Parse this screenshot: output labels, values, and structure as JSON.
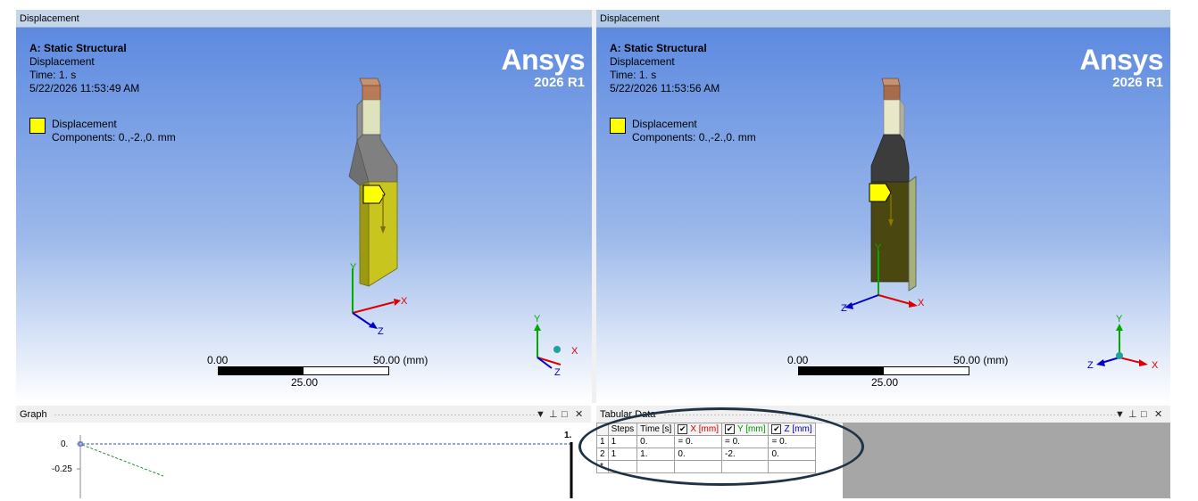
{
  "left_pane": {
    "title": "Displacement",
    "info": {
      "analysis": "A: Static Structural",
      "result": "Displacement",
      "time": "Time: 1. s",
      "date": "5/22/2026 11:53:49 AM"
    },
    "legend": {
      "label": "Displacement",
      "components": "Components: 0.,-2.,0. mm"
    },
    "brand": {
      "name": "Ansys",
      "version": "2026 R1"
    },
    "scale": {
      "min": "0.00",
      "max": "50.00 (mm)",
      "mid": "25.00"
    },
    "triad_model": {
      "x": "X",
      "y": "Y",
      "z": "Z"
    },
    "triad_corner": {
      "x": "X",
      "y": "Y",
      "z": "Z"
    }
  },
  "right_pane": {
    "title": "Displacement",
    "info": {
      "analysis": "A: Static Structural",
      "result": "Displacement",
      "time": "Time: 1. s",
      "date": "5/22/2026 11:53:56 AM"
    },
    "legend": {
      "label": "Displacement",
      "components": "Components: 0.,-2.,0. mm"
    },
    "brand": {
      "name": "Ansys",
      "version": "2026 R1"
    },
    "scale": {
      "min": "0.00",
      "max": "50.00 (mm)",
      "mid": "25.00"
    },
    "triad_model": {
      "x": "X",
      "y": "Y",
      "z": "Z"
    },
    "triad_corner": {
      "x": "X",
      "y": "Y",
      "z": "Z"
    }
  },
  "graph": {
    "title": "Graph",
    "controls": {
      "dropdown": "▼",
      "pin": "⊥",
      "maximize": "□",
      "close": "✕"
    },
    "y_ticks": [
      "0.",
      "-0.25"
    ],
    "x_marker": "1.",
    "colors": {
      "x_series": "#2d4bd6",
      "y_series": "#2a8a2a"
    }
  },
  "tabular": {
    "title": "Tabular Data",
    "controls": {
      "dropdown": "▼",
      "pin": "⊥",
      "maximize": "□",
      "close": "✕"
    },
    "headers": {
      "steps": "Steps",
      "time": "Time [s]",
      "x": "X [mm]",
      "y": "Y [mm]",
      "z": "Z [mm]"
    },
    "rows": [
      {
        "index": "1",
        "steps": "1",
        "time": "0.",
        "x": "= 0.",
        "y": "= 0.",
        "z": "= 0."
      },
      {
        "index": "2",
        "steps": "1",
        "time": "1.",
        "x": "0.",
        "y": "-2.",
        "z": "0."
      },
      {
        "index": "*",
        "steps": "",
        "time": "",
        "x": "",
        "y": "",
        "z": ""
      }
    ],
    "check_mark": "✔",
    "colors": {
      "x": "#cc0000",
      "y": "#009900",
      "z": "#0000cc"
    }
  }
}
